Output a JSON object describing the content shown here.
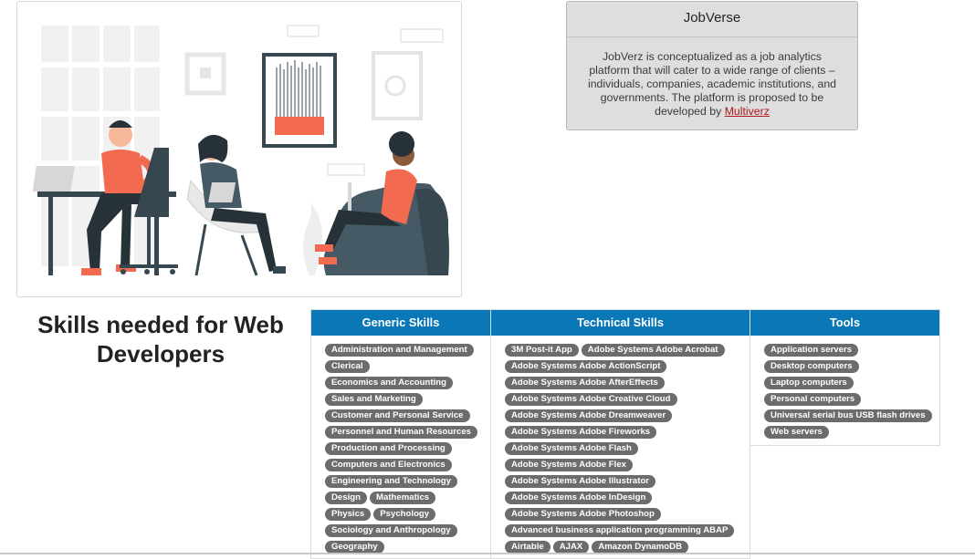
{
  "info_card": {
    "title": "JobVerse",
    "body": "JobVerz is conceptualized as a job analytics platform that will cater to a wide range of clients – individuals, companies, academic institutions, and governments. The platform is proposed to be developed by ",
    "link": "Multiverz"
  },
  "heading": "Skills needed for Web Developers",
  "columns": {
    "generic": {
      "title": "Generic Skills",
      "items": [
        "Administration and Management",
        "Clerical",
        "Economics and Accounting",
        "Sales and Marketing",
        "Customer and Personal Service",
        "Personnel and Human Resources",
        "Production and Processing",
        "Computers and Electronics",
        "Engineering and Technology",
        "Design",
        "Mathematics",
        "Physics",
        "Psychology",
        "Sociology and Anthropology",
        "Geography"
      ]
    },
    "technical": {
      "title": "Technical Skills",
      "items": [
        "3M Post-it App",
        "Adobe Systems Adobe Acrobat",
        "Adobe Systems Adobe ActionScript",
        "Adobe Systems Adobe AfterEffects",
        "Adobe Systems Adobe Creative Cloud",
        "Adobe Systems Adobe Dreamweaver",
        "Adobe Systems Adobe Fireworks",
        "Adobe Systems Adobe Flash",
        "Adobe Systems Adobe Flex",
        "Adobe Systems Adobe Illustrator",
        "Adobe Systems Adobe InDesign",
        "Adobe Systems Adobe Photoshop",
        "Advanced business application programming ABAP",
        "Airtable",
        "AJAX",
        "Amazon DynamoDB"
      ]
    },
    "tools": {
      "title": "Tools",
      "items": [
        "Application servers",
        "Desktop computers",
        "Laptop computers",
        "Personal computers",
        "Universal serial bus USB flash drives",
        "Web servers"
      ]
    }
  },
  "colors": {
    "header_blue": "#0a78b6",
    "badge_gray": "#6c6c6c",
    "link_red": "#b0161b",
    "card_bg": "#dedede"
  }
}
